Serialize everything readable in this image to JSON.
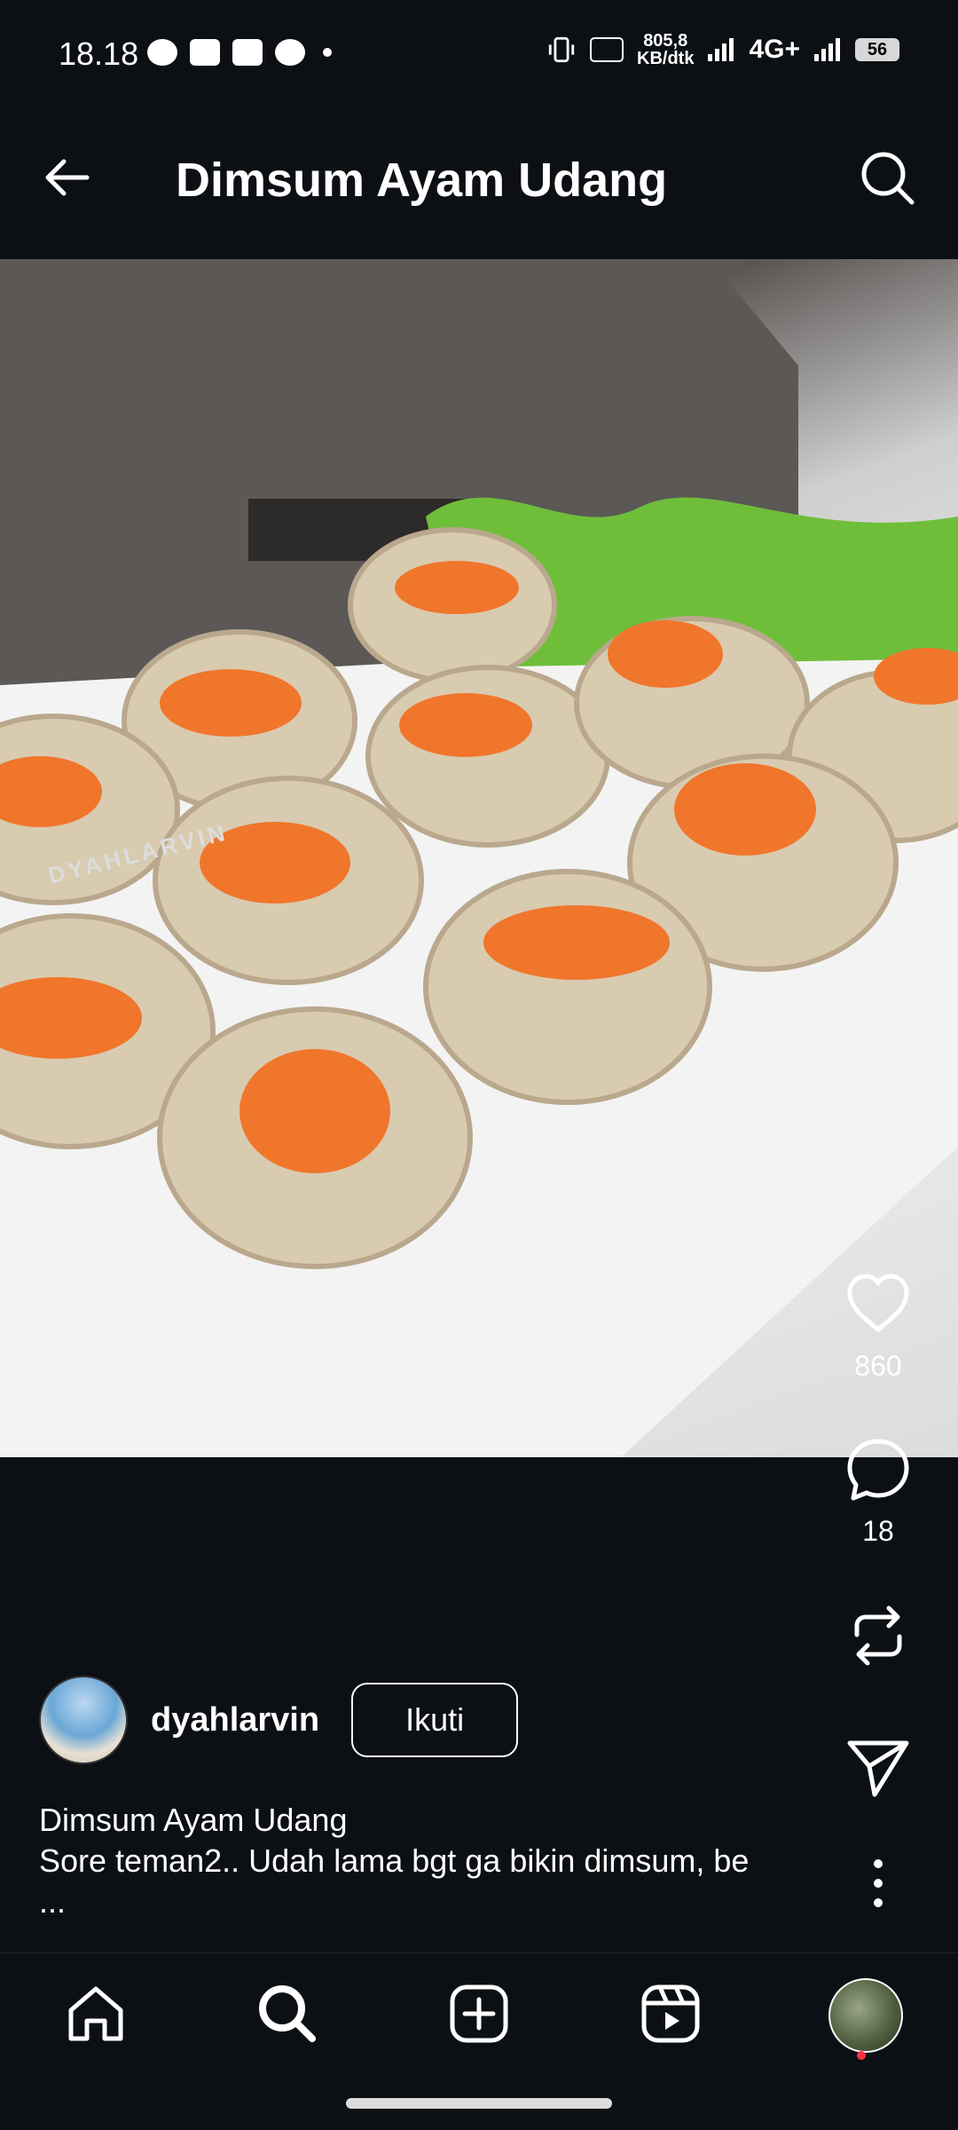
{
  "status_bar": {
    "time": "18.18",
    "network_speed_line1": "805,8",
    "network_speed_line2": "KB/dtk",
    "network_type": "4G+",
    "battery": "56",
    "icons": [
      "whatsapp-icon",
      "youtube-icon",
      "vivo-icon",
      "whatsapp-icon",
      "dot-icon",
      "vibrate-icon",
      "volte-icon",
      "signal-icon",
      "signal-icon",
      "battery-icon"
    ]
  },
  "header": {
    "title": "Dimsum Ayam Udang",
    "back_icon": "arrow-left-icon",
    "search_icon": "search-icon"
  },
  "post": {
    "image_watermark": "DYAHLARVIN",
    "likes": "860",
    "comments": "18",
    "author": "dyahlarvin",
    "follow_label": "Ikuti",
    "caption_title": "Dimsum Ayam Udang",
    "caption_text": "Sore teman2.. Udah lama bgt ga bikin dimsum, be",
    "caption_more": "..."
  },
  "nav": {
    "items": [
      "home-icon",
      "search-icon",
      "add-post-icon",
      "reels-icon",
      "profile-avatar"
    ]
  },
  "colors": {
    "background": "#0c1014",
    "text": "#ffffff",
    "notification_dot": "#ff3040"
  }
}
